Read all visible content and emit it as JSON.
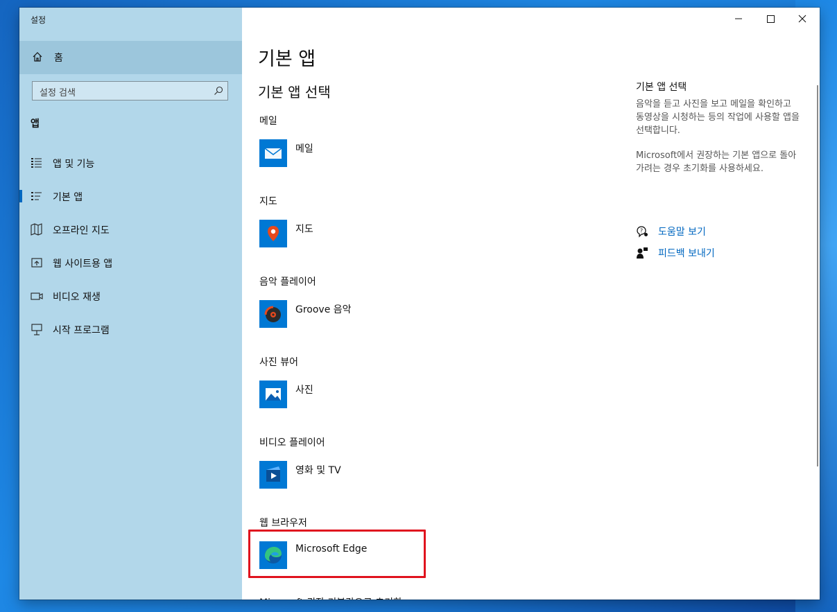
{
  "window": {
    "title": "설정"
  },
  "sidebar": {
    "home_label": "홈",
    "search_placeholder": "설정 검색",
    "section_heading": "앱",
    "items": [
      {
        "label": "앱 및 기능",
        "icon": "apps-features-icon"
      },
      {
        "label": "기본 앱",
        "icon": "default-apps-icon",
        "active": true
      },
      {
        "label": "오프라인 지도",
        "icon": "offline-maps-icon"
      },
      {
        "label": "웹 사이트용 앱",
        "icon": "apps-for-websites-icon"
      },
      {
        "label": "비디오 재생",
        "icon": "video-playback-icon"
      },
      {
        "label": "시작 프로그램",
        "icon": "startup-icon"
      }
    ]
  },
  "main": {
    "page_title": "기본 앱",
    "sub_title": "기본 앱 선택",
    "categories": [
      {
        "label": "메일",
        "app": "메일",
        "icon": "mail-icon"
      },
      {
        "label": "지도",
        "app": "지도",
        "icon": "maps-icon"
      },
      {
        "label": "음악 플레이어",
        "app": "Groove 음악",
        "icon": "groove-music-icon"
      },
      {
        "label": "사진 뷰어",
        "app": "사진",
        "icon": "photos-icon"
      },
      {
        "label": "비디오 플레이어",
        "app": "영화 및 TV",
        "icon": "movies-tv-icon"
      },
      {
        "label": "웹 브라우저",
        "app": "Microsoft Edge",
        "icon": "edge-icon"
      }
    ],
    "cut_off_text": "Microsoft 권장 기본값으로 초기화"
  },
  "right_panel": {
    "title": "기본 앱 선택",
    "desc1": "음악을 듣고 사진을 보고 메일을 확인하고 동영상을 시청하는 등의 작업에 사용할 앱을 선택합니다.",
    "desc2": "Microsoft에서 권장하는 기본 앱으로 돌아가려는 경우 초기화를 사용하세요.",
    "links": [
      {
        "label": "도움말 보기",
        "icon": "help-icon"
      },
      {
        "label": "피드백 보내기",
        "icon": "feedback-icon"
      }
    ]
  },
  "colors": {
    "accent": "#0078d4",
    "sidebar_bg": "#b2d7ea",
    "highlight": "#e0131e",
    "link": "#0067c0"
  }
}
